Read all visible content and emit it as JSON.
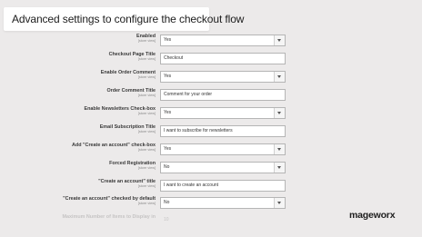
{
  "banner": {
    "title": "Advanced settings to configure the checkout flow"
  },
  "settings": [
    {
      "label": "Enabled",
      "scope": "[store view]",
      "type": "select",
      "value": "Yes"
    },
    {
      "label": "Checkout Page Title",
      "scope": "[store view]",
      "type": "text",
      "value": "Checkout"
    },
    {
      "label": "Enable Order Comment",
      "scope": "[store view]",
      "type": "select",
      "value": "Yes"
    },
    {
      "label": "Order Comment Title",
      "scope": "[store view]",
      "type": "text",
      "value": "Comment for your order"
    },
    {
      "label": "Enable Newsletters Check-box",
      "scope": "[store view]",
      "type": "select",
      "value": "Yes"
    },
    {
      "label": "Email Subscription Title",
      "scope": "[store view]",
      "type": "text",
      "value": "I want to subscribe for newsletters"
    },
    {
      "label": "Add \"Create an account\" check-box",
      "scope": "[store view]",
      "type": "select",
      "value": "Yes"
    },
    {
      "label": "Forced Registration",
      "scope": "[store view]",
      "type": "select",
      "value": "No"
    },
    {
      "label": "\"Create an account\" title",
      "scope": "[store view]",
      "type": "text",
      "value": "I want to create an account"
    },
    {
      "label": "\"Create an account\" checked by default",
      "scope": "[store view]",
      "type": "select",
      "value": "No"
    }
  ],
  "partial_row": {
    "label": "Maximum Number of Items to Display in",
    "value": "10"
  },
  "brand": {
    "logo_text": "mageworx"
  }
}
